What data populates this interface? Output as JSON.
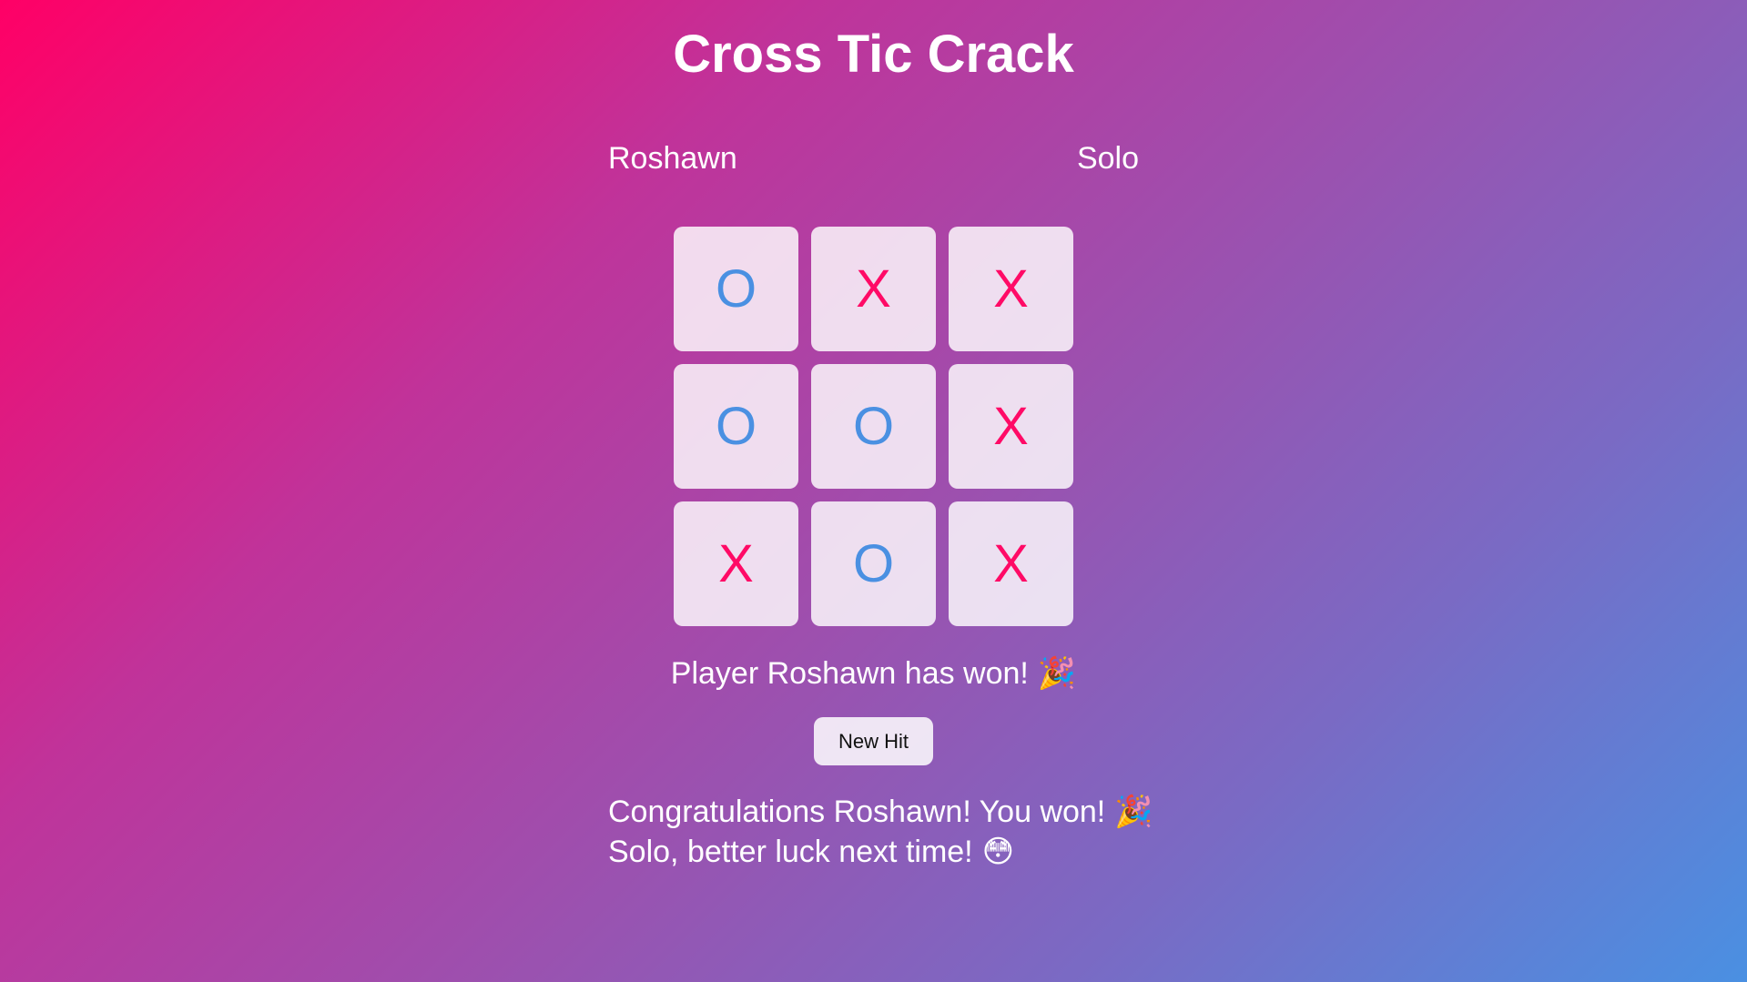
{
  "title": "Cross Tic Crack",
  "players": {
    "left": "Roshawn",
    "right": "Solo"
  },
  "colors": {
    "x": "#ff0a66",
    "o": "#4a90e2"
  },
  "board": [
    [
      "O",
      "X",
      "X"
    ],
    [
      "O",
      "O",
      "X"
    ],
    [
      "X",
      "O",
      "X"
    ]
  ],
  "status": {
    "text": "Player Roshawn has won!",
    "emoji": "🎉"
  },
  "new_button_label": "New Hit",
  "messages": {
    "winner_text": "Congratulations Roshawn! You won!",
    "winner_emoji": "🎉",
    "loser_text": "Solo, better luck next time!",
    "loser_emoji": "😳"
  }
}
